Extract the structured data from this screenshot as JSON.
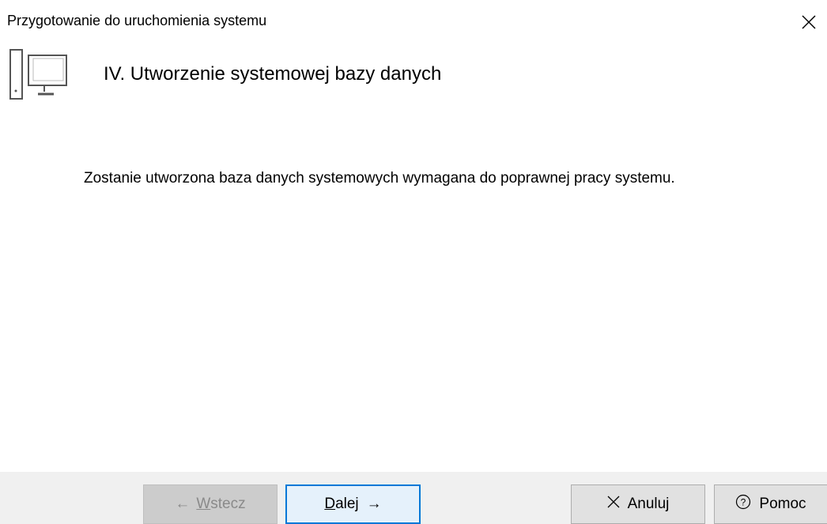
{
  "window": {
    "title": "Przygotowanie do uruchomienia systemu"
  },
  "step": {
    "icon": "computer-icon",
    "title": "IV. Utworzenie systemowej bazy danych",
    "description": "Zostanie utworzona baza danych systemowych wymagana do poprawnej pracy systemu."
  },
  "buttons": {
    "back": {
      "arrow": "←",
      "accel": "W",
      "rest": "stecz",
      "enabled": false
    },
    "next": {
      "accel": "D",
      "rest": "alej",
      "arrow": "→"
    },
    "cancel": {
      "icon": "×",
      "label": "Anuluj"
    },
    "help": {
      "icon": "?",
      "label": "Pomoc"
    }
  },
  "colors": {
    "accent": "#0078d7",
    "footer_bg": "#f0f0f0",
    "disabled_text": "#8a8a8a"
  }
}
